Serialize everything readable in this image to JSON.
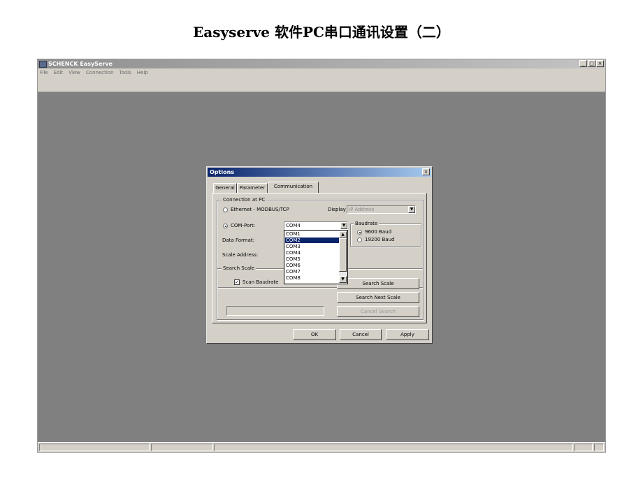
{
  "slide": {
    "title": "Easyserve 软件PC串口通讯设置（二）"
  },
  "app": {
    "title": "SCHENCK EasyServe",
    "menu": [
      "File",
      "Edit",
      "View",
      "Connection",
      "Tools",
      "Help"
    ],
    "window_buttons": {
      "minimize": "_",
      "maximize": "□",
      "close": "×"
    }
  },
  "dialog": {
    "title": "Options",
    "close": "×",
    "tabs": [
      "General",
      "Parameter",
      "Communication"
    ],
    "active_tab": "Communication",
    "connection": {
      "label": "Connection at PC",
      "ethernet_label": "Ethernet - MODBUS/TCP",
      "display_label": "Display",
      "display_value": "IP Address",
      "comport_label": "COM-Port:",
      "comport_value": "COM4",
      "data_format_label": "Data Format:",
      "scale_address_label": "Scale Address:",
      "baudrate": {
        "label": "Baudrate",
        "options": [
          "9600 Baud",
          "19200 Baud"
        ],
        "selected": "9600 Baud"
      }
    },
    "dropdown": {
      "items": [
        "COM1",
        "COM2",
        "COM3",
        "COM4",
        "COM5",
        "COM6",
        "COM7",
        "COM8"
      ],
      "highlighted": "COM2"
    },
    "search": {
      "label": "Search Scale",
      "scan_baudrate_label": "Scan Baudrate",
      "scan_checked": true,
      "search_button": "Search Scale",
      "search_next_button": "Search Next Scale",
      "cancel_search_button": "Cancel Search"
    },
    "buttons": {
      "ok": "OK",
      "cancel": "Cancel",
      "apply": "Apply"
    }
  },
  "icons": {
    "arrow_down": "▼",
    "arrow_up": "▲",
    "check": "✓"
  }
}
